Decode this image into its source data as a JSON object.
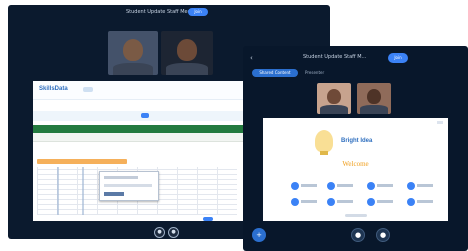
{
  "desktop": {
    "title": "Student Update Staff Meeting",
    "pill_label": "Join",
    "share": {
      "brand": "SkillsData",
      "dialog_title": ""
    },
    "controls": {
      "mic": "●",
      "cam": "●"
    }
  },
  "mobile": {
    "back": "‹",
    "title": "Student Update Staff M...",
    "pill_label": "Join",
    "shared_label": "Shared Content",
    "sub_label": "Presenter",
    "slide": {
      "brand": "Bright Idea",
      "welcome": "Welcome"
    },
    "controls": {
      "plus": "+",
      "mic": "●",
      "cam": "●"
    }
  }
}
